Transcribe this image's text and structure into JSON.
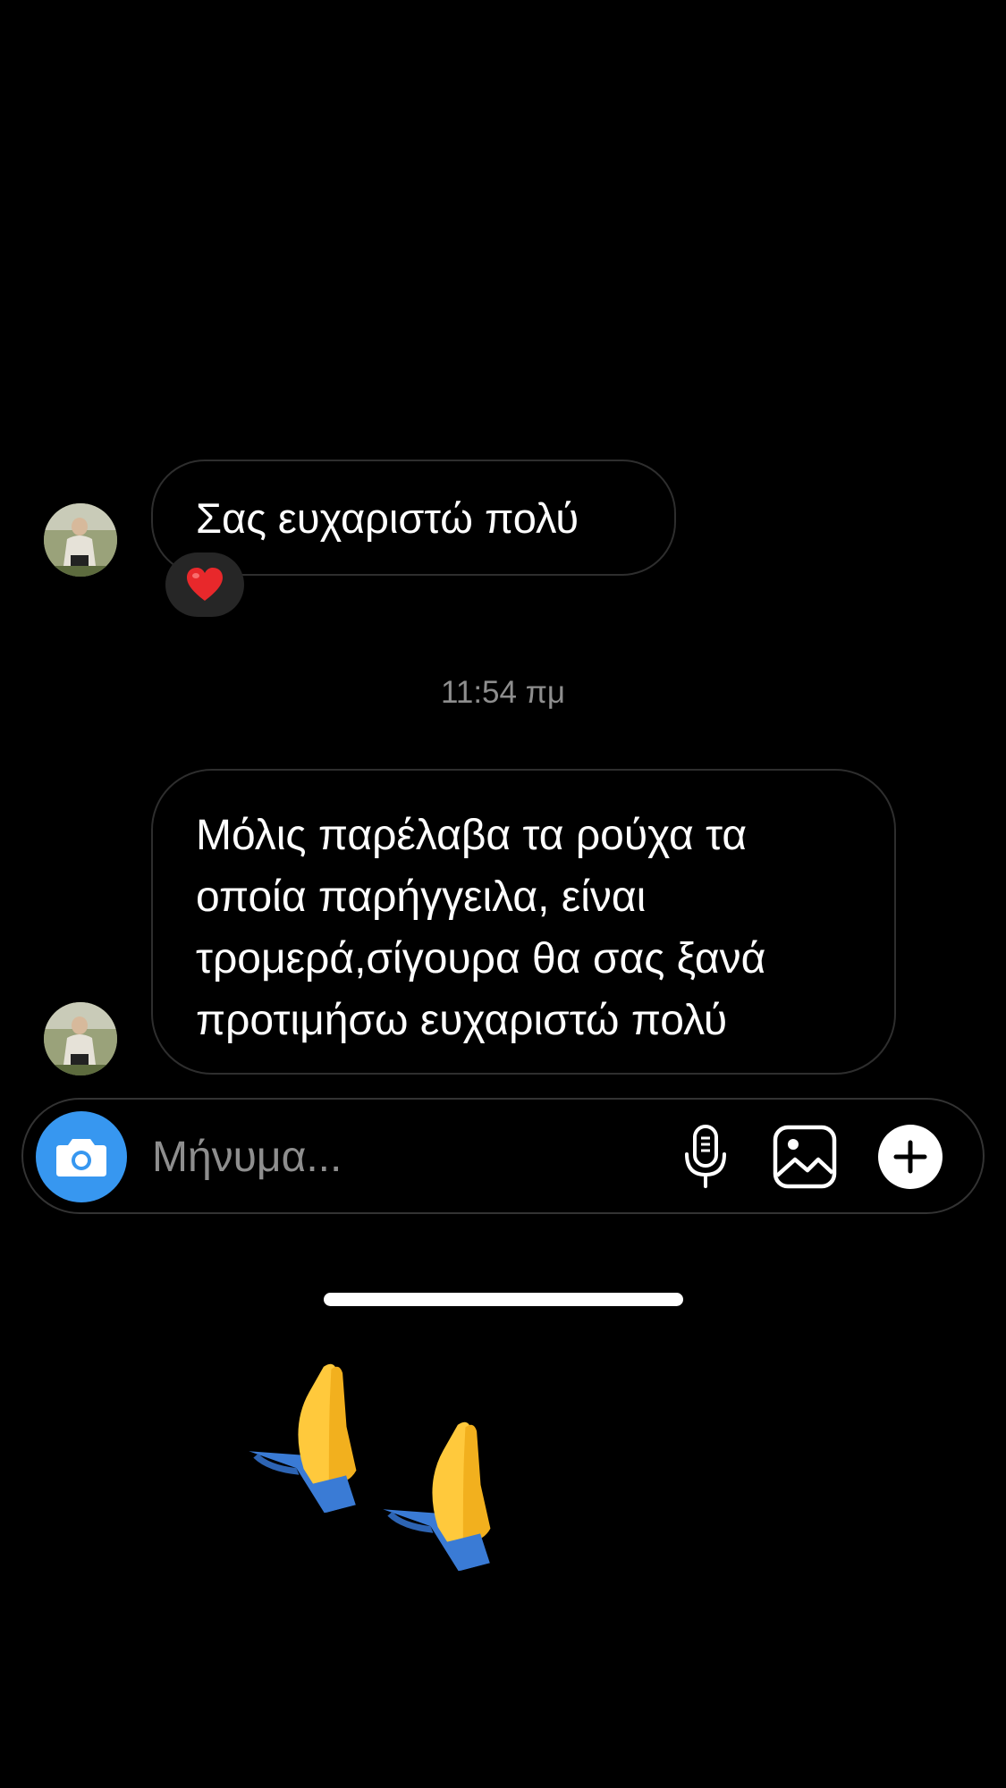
{
  "conversation": {
    "messages": [
      {
        "lines": [
          "Σας ευχαριστώ πολύ"
        ],
        "reaction": "red-heart"
      },
      {
        "lines": [
          "Μόλις παρέλαβα τα ρούχα τα",
          "οποία παρήγγειλα, είναι",
          "τρομερά,σίγουρα θα σας ξανά",
          "προτιμήσω ευχαριστώ πολύ"
        ]
      }
    ],
    "timestamp": "11:54 πμ"
  },
  "composer": {
    "placeholder": "Μήνυμα...",
    "accent_color": "#3797f0",
    "icons": [
      "camera-icon",
      "microphone-icon",
      "gallery-icon",
      "plus-icon"
    ]
  },
  "decoration": {
    "icons": [
      "praying-hands-icon",
      "praying-hands-icon"
    ]
  }
}
